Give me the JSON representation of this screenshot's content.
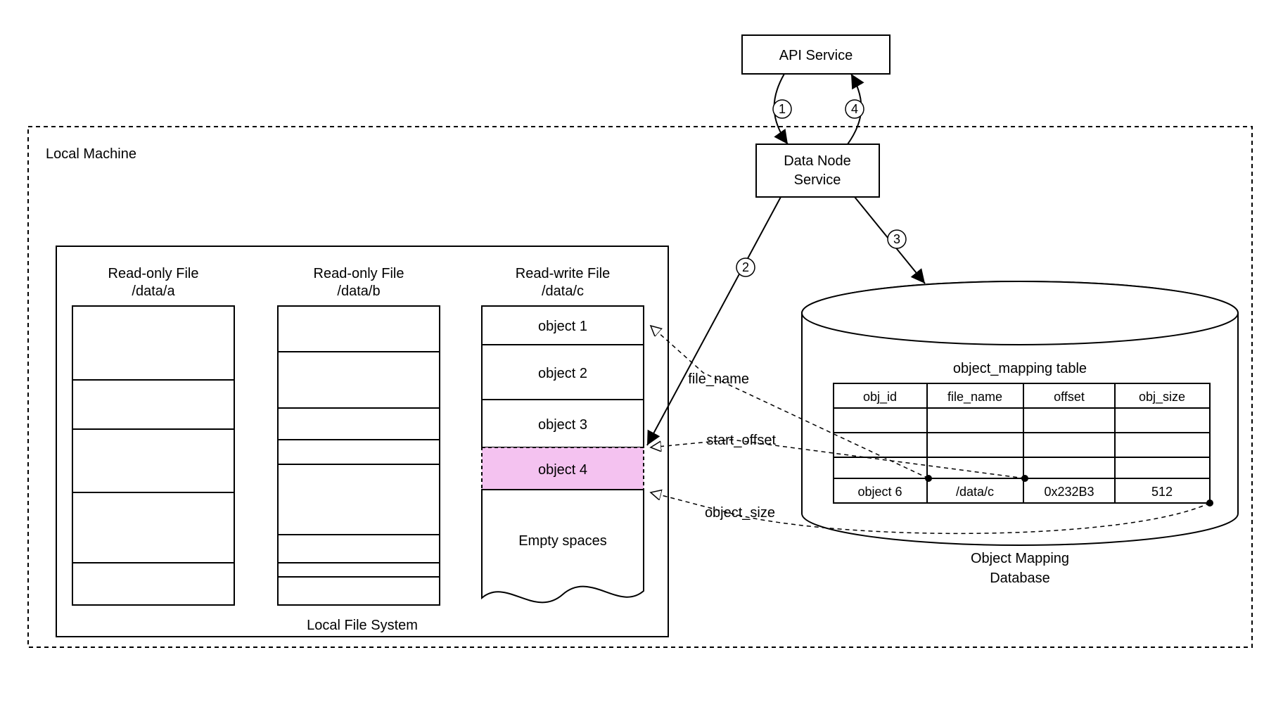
{
  "boxes": {
    "api_service": "API Service",
    "data_node_service_line1": "Data Node",
    "data_node_service_line2": "Service",
    "local_machine": "Local Machine",
    "local_fs": "Local File System"
  },
  "files": {
    "a_title_line1": "Read-only File",
    "a_title_line2": "/data/a",
    "b_title_line1": "Read-only File",
    "b_title_line2": "/data/b",
    "c_title_line1": "Read-write File",
    "c_title_line2": "/data/c",
    "c_cells": [
      "object 1",
      "object 2",
      "object 3",
      "object 4",
      "Empty spaces"
    ]
  },
  "db": {
    "title": "object_mapping table",
    "caption_line1": "Object Mapping",
    "caption_line2": "Database",
    "headers": [
      "obj_id",
      "file_name",
      "offset",
      "obj_size"
    ],
    "row": [
      "object 6",
      "/data/c",
      "0x232B3",
      "512"
    ]
  },
  "arrows": {
    "file_name": "file_name",
    "start_offset": "start_offset",
    "object_size": "object_size"
  },
  "steps": {
    "s1": "1",
    "s2": "2",
    "s3": "3",
    "s4": "4"
  }
}
